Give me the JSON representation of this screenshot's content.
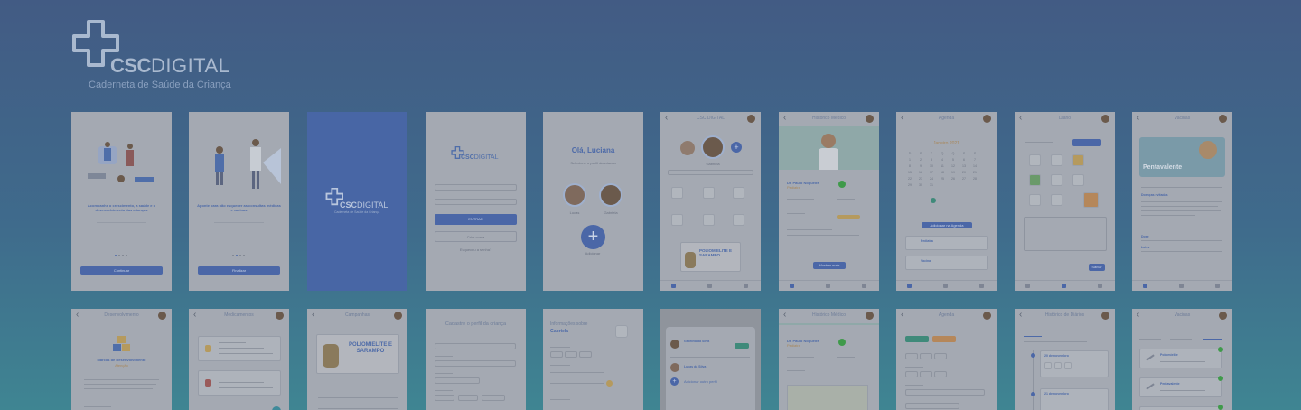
{
  "brand": {
    "name_bold": "CSC",
    "name_light": "DIGITAL",
    "tagline": "Caderneta de Saúde da Criança"
  },
  "screens": {
    "onboarding1": {
      "headline": "Acompanhe o crescimento, a saúde e o desenvolvimento das crianças",
      "button": "Continuar"
    },
    "onboarding2": {
      "headline": "Aponte para não esquecer as consultas médicas e vacinas",
      "button": "Finalizar"
    },
    "splash": {
      "brand_bold": "CSC",
      "brand_light": "DIGITAL",
      "tagline": "Caderneta de Saúde da Criança"
    },
    "login": {
      "brand_bold": "CSC",
      "brand_light": "DIGITAL",
      "button": "ENTRAR",
      "button2": "Criar conta",
      "link": "Esqueceu a senha?"
    },
    "profiles": {
      "greeting": "Olá, Luciana",
      "subtitle": "Selecione o perfil da criança",
      "child1": "Lucas",
      "child2": "Gabriela",
      "add": "Adicionar"
    },
    "home": {
      "title": "CSC DIGITAL",
      "child": "Gabriela",
      "banner": "POLIOMIELITE E SARAMPO"
    },
    "history": {
      "title": "Histórico Médico",
      "doctor": "Dr. Paulo Nogueira",
      "specialty": "Pediatra",
      "button": "Mostrar mais"
    },
    "agenda": {
      "title": "Agenda",
      "month": "Janeiro 2021",
      "button": "Adicionar na Agenda",
      "item1": "Pediatra",
      "item2": "Vacina"
    },
    "diary": {
      "title": "Diário",
      "button": "Salvar"
    },
    "vaccines": {
      "title": "Vacinas",
      "banner": "Pentavalente",
      "label1": "Doenças evitadas",
      "label2": "Dose",
      "label3": "Lotes"
    },
    "development": {
      "title": "Desenvolvimento",
      "headline": "Marcos de Desenvolvimento",
      "subtitle": "Atenção"
    },
    "medicines": {
      "title": "Medicamentos"
    },
    "campaigns": {
      "title": "Campanhas",
      "banner": "POLIOMIELITE E SARAMPO"
    },
    "register": {
      "title": "Cadastre o perfil da criança"
    },
    "info": {
      "title": "Informações sobre",
      "name": "Gabriela"
    },
    "profile_switch": {
      "child1": "Gabriela da Silva",
      "child2": "Lucas da Silva",
      "add": "Adicionar outro perfil"
    },
    "history2": {
      "title": "Histórico Médico",
      "doctor": "Dr. Paulo Nogueira",
      "specialty": "Pediatra"
    },
    "agenda2": {
      "title": "Agenda"
    },
    "disease_history": {
      "title": "Histórico de Diários",
      "day1": "20 de novembro",
      "day2": "21 de novembro"
    },
    "vaccines2": {
      "title": "Vacinas",
      "item1": "Poliomielite",
      "item2": "Pentavalente"
    }
  }
}
